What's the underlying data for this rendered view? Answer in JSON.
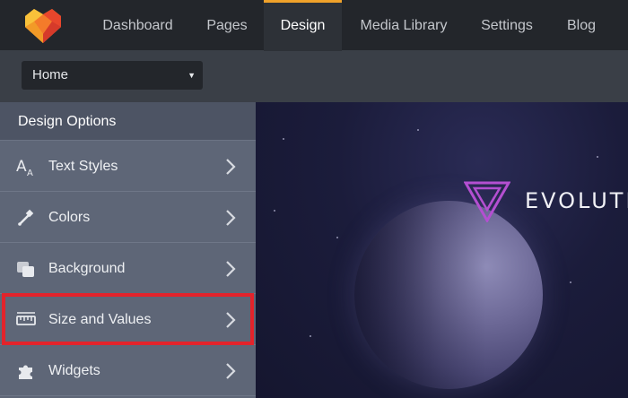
{
  "nav": {
    "items": [
      {
        "label": "Dashboard",
        "active": false
      },
      {
        "label": "Pages",
        "active": false
      },
      {
        "label": "Design",
        "active": true
      },
      {
        "label": "Media Library",
        "active": false
      },
      {
        "label": "Settings",
        "active": false
      },
      {
        "label": "Blog",
        "active": false
      }
    ],
    "accent_color": "#f0a22a"
  },
  "subbar": {
    "page_select": {
      "value": "Home"
    }
  },
  "sidebar": {
    "title": "Design Options",
    "items": [
      {
        "label": "Text Styles",
        "icon": "text-styles-icon"
      },
      {
        "label": "Colors",
        "icon": "color-picker-icon"
      },
      {
        "label": "Background",
        "icon": "background-icon"
      },
      {
        "label": "Size and Values",
        "icon": "ruler-icon",
        "highlighted": true
      },
      {
        "label": "Widgets",
        "icon": "puzzle-icon"
      }
    ],
    "highlight_color": "#e3232b"
  },
  "preview": {
    "brand_text": "EVOLUTIC"
  }
}
